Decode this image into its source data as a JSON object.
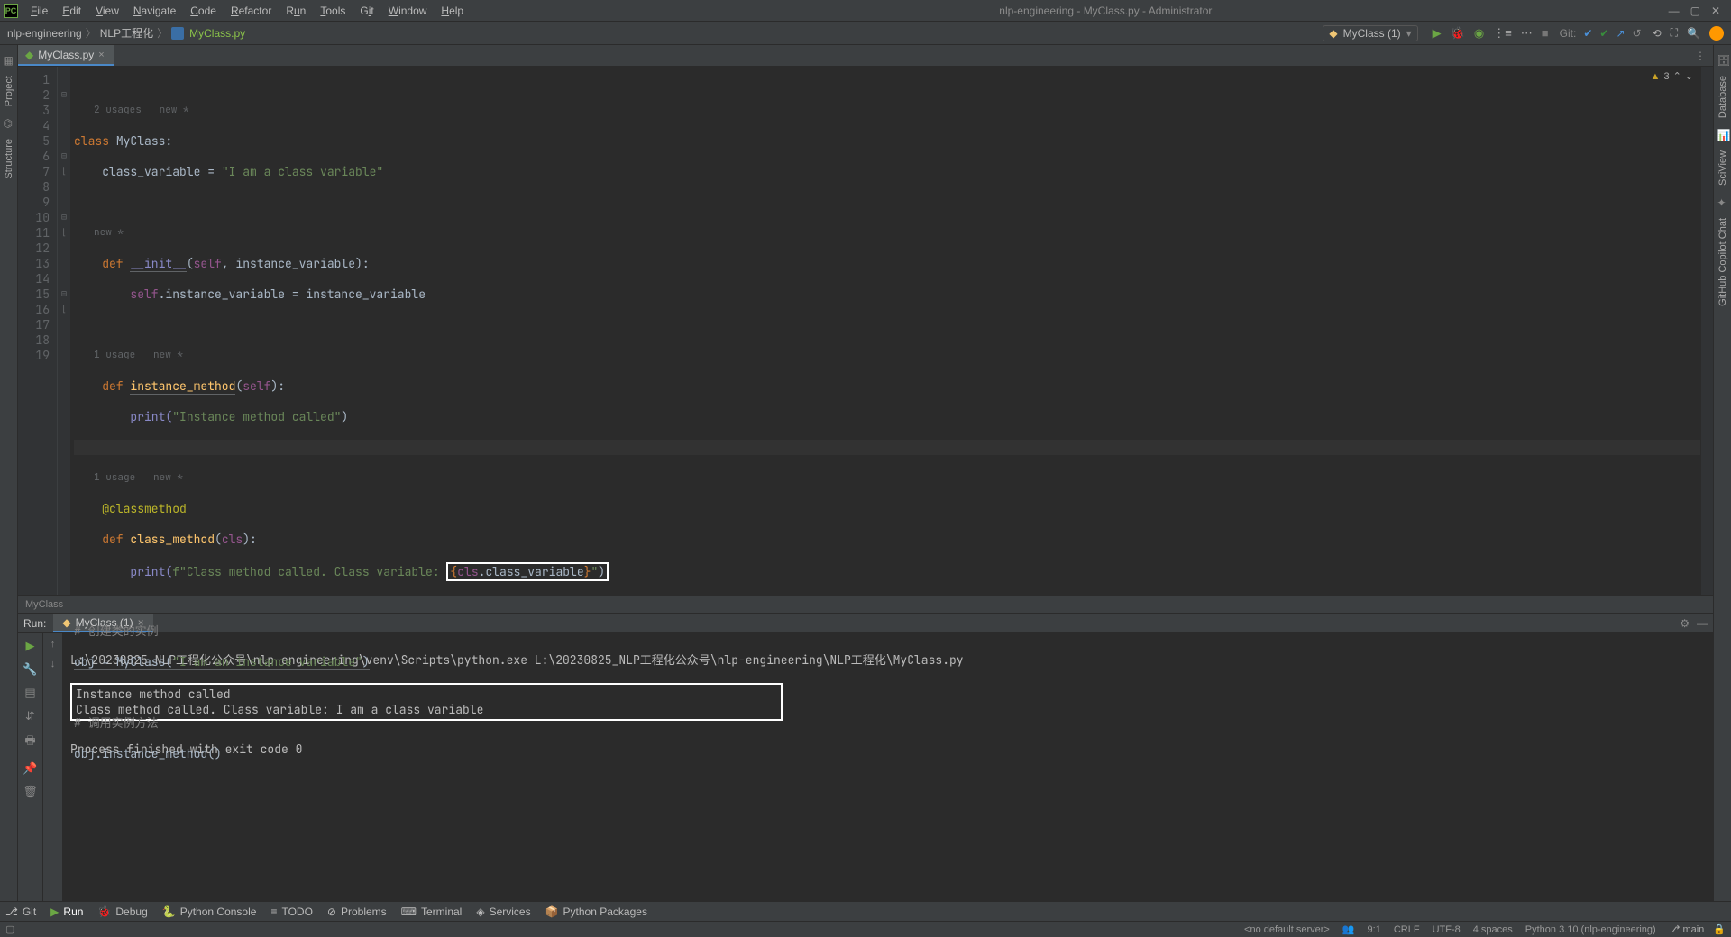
{
  "window": {
    "title": "nlp-engineering - MyClass.py - Administrator"
  },
  "menu": [
    "File",
    "Edit",
    "View",
    "Navigate",
    "Code",
    "Refactor",
    "Run",
    "Tools",
    "Git",
    "Window",
    "Help"
  ],
  "breadcrumb": {
    "root": "nlp-engineering",
    "folder": "NLP工程化",
    "file": "MyClass.py"
  },
  "runConfig": {
    "name": "MyClass (1)"
  },
  "gitLabel": "Git:",
  "leftGutter": [
    "Project",
    "Structure"
  ],
  "rightGutter": [
    "Database",
    "SciView",
    "GitHub Copilot Chat"
  ],
  "editorTab": {
    "name": "MyClass.py"
  },
  "editor": {
    "warningCount": "3",
    "hints": {
      "l0": "2 usages   new *",
      "l_init": "new *",
      "l_inst": "1 usage   new *",
      "l_cls": "1 usage   new *"
    },
    "code": {
      "l1_a": "class ",
      "l1_b": "MyClass:",
      "l2_a": "    class_variable = ",
      "l2_b": "\"I am a class variable\"",
      "l4_a": "    ",
      "l4_def": "def ",
      "l4_name": "__init__",
      "l4_c": "(",
      "l4_self": "self",
      "l4_d": ", instance_variable):",
      "l5_a": "        ",
      "l5_self": "self",
      "l5_b": ".instance_variable = instance_variable",
      "l7_def": "    def ",
      "l7_name": "instance_method",
      "l7_c": "(",
      "l7_self": "self",
      "l7_d": "):",
      "l8_a": "        ",
      "l8_print": "print(",
      "l8_str": "\"Instance method called\"",
      "l8_b": ")",
      "l10": "    @classmethod",
      "l11_def": "    def ",
      "l11_name": "class_method",
      "l11_c": "(",
      "l11_cls": "cls",
      "l11_d": "):",
      "l12_a": "        ",
      "l12_print": "print(",
      "l12_f": "f\"Class method called. Class variable: ",
      "l12_open": "{",
      "l12_cls": "cls",
      "l12_dot": ".class_variable",
      "l12_close": "}",
      "l12_end": "\"",
      "l12_rp": ")",
      "l14": "# 创建类的实例",
      "l15_a": "obj = ",
      "l15_b": "MyClass(",
      "l15_str": "\"I am an instance variable\"",
      "l15_c": ")",
      "l17": "# 调用实例方法",
      "l18": "obj.instance_method()"
    },
    "breadcrumbBottom": "MyClass"
  },
  "runPanel": {
    "label": "Run:",
    "tab": "MyClass (1)",
    "cmd": "L:\\20230825_NLP工程化公众号\\nlp-engineering\\venv\\Scripts\\python.exe L:\\20230825_NLP工程化公众号\\nlp-engineering\\NLP工程化\\MyClass.py",
    "out1": "Instance method called",
    "out2": "Class method called. Class variable: I am a class variable",
    "exit": "Process finished with exit code 0"
  },
  "bottomBar": {
    "git": "Git",
    "run": "Run",
    "debug": "Debug",
    "pyconsole": "Python Console",
    "todo": "TODO",
    "problems": "Problems",
    "terminal": "Terminal",
    "services": "Services",
    "pypkg": "Python Packages"
  },
  "status": {
    "server": "<no default server>",
    "pos": "9:1",
    "eol": "CRLF",
    "enc": "UTF-8",
    "indent": "4 spaces",
    "interp": "Python 3.10 (nlp-engineering)",
    "branch": "main"
  }
}
